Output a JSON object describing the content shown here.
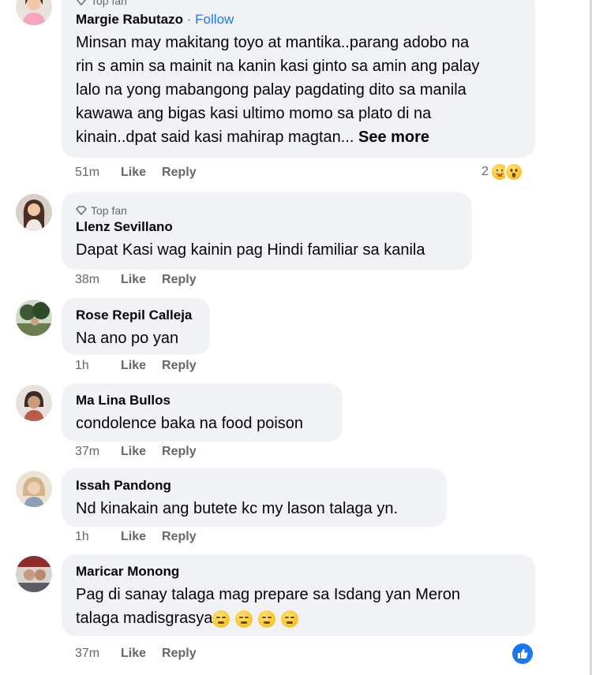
{
  "comments": [
    {
      "badge": "Top fan",
      "author": "Margie Rabutazo",
      "follow": "Follow",
      "text_lines": [
        "Minsan may makitang toyo at mantika..parang adobo na",
        "rin s amin sa mainit na kanin kasi ginto sa amin ang palay",
        "lalo na yong mabangong palay pagdating dito sa manila",
        "kawawa ang bigas kasi ultimo momo sa plato di na",
        "kinain..dpat said kasi mahirap magtan..."
      ],
      "see_more": "See more",
      "time": "51m",
      "like": "Like",
      "reply": "Reply",
      "reaction_count": "2"
    },
    {
      "badge": "Top fan",
      "author": "Llenz Sevillano",
      "text": "Dapat Kasi wag kainin pag Hindi familiar sa kanila",
      "time": "38m",
      "like": "Like",
      "reply": "Reply"
    },
    {
      "author": "Rose Repil Calleja",
      "text": "Na ano po yan",
      "time": "1h",
      "like": "Like",
      "reply": "Reply"
    },
    {
      "author": "Ma Lina Bullos",
      "text": "condolence baka na food poison",
      "time": "37m",
      "like": "Like",
      "reply": "Reply"
    },
    {
      "author": "Issah Pandong",
      "text": "Nd kinakain ang butete kc my lason talaga yn.",
      "time": "1h",
      "like": "Like",
      "reply": "Reply"
    },
    {
      "author": "Maricar Monong",
      "text_lines": [
        "Pag di sanay talaga mag prepare sa Isdang yan Meron",
        "talaga madisgrasya"
      ],
      "time": "37m",
      "like": "Like",
      "reply": "Reply"
    }
  ],
  "colors": {
    "accent": "#1877f2",
    "bubble": "#f0f2f5",
    "meta_text": "#65676b"
  },
  "icons": {
    "badge": "diamond-icon",
    "reaction_1": "care-emoji-icon",
    "reaction_2": "wow-emoji-icon",
    "floating": "like-thumb-icon",
    "sad_emoji": "weary-face-emoji-icon"
  }
}
